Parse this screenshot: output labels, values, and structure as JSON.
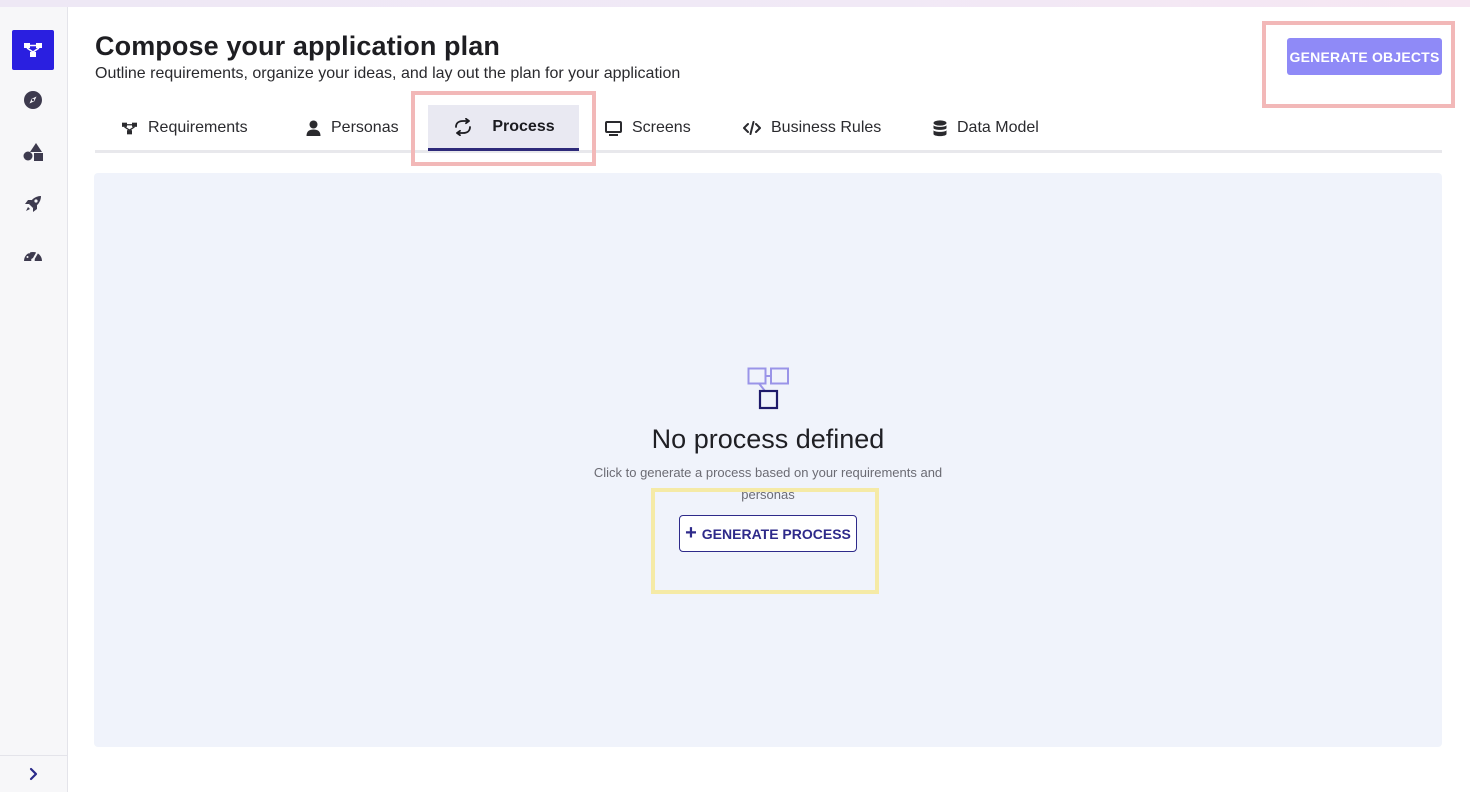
{
  "header": {
    "title": "Compose your application plan",
    "subtitle": "Outline requirements, organize your ideas, and lay out the plan for your application",
    "generate_objects_label": "GENERATE OBJECTS"
  },
  "sidebar": {
    "items": [
      {
        "icon": "hierarchy-icon",
        "active": true
      },
      {
        "icon": "compass-icon",
        "active": false
      },
      {
        "icon": "shapes-icon",
        "active": false
      },
      {
        "icon": "rocket-icon",
        "active": false
      },
      {
        "icon": "gauge-icon",
        "active": false
      }
    ],
    "expand_icon": "chevron-right-icon"
  },
  "tabs": [
    {
      "label": "Requirements",
      "icon": "hierarchy-icon",
      "active": false
    },
    {
      "label": "Personas",
      "icon": "user-icon",
      "active": false
    },
    {
      "label": "Process",
      "icon": "refresh-icon",
      "active": true
    },
    {
      "label": "Screens",
      "icon": "monitor-icon",
      "active": false
    },
    {
      "label": "Business Rules",
      "icon": "code-icon",
      "active": false
    },
    {
      "label": "Data Model",
      "icon": "database-icon",
      "active": false
    }
  ],
  "empty_state": {
    "icon": "process-diagram-icon",
    "title": "No process defined",
    "description": "Click to generate a process based on your requirements and personas",
    "button_label": "GENERATE PROCESS",
    "button_icon": "plus-icon"
  },
  "colors": {
    "accent": "#2a1fe0",
    "primary_button": "#8f8af7",
    "outline_button": "#2e2a8a",
    "panel_bg": "#f0f3fb",
    "highlight_red": "#f2b8b8",
    "highlight_yellow": "#f5eaa6"
  }
}
